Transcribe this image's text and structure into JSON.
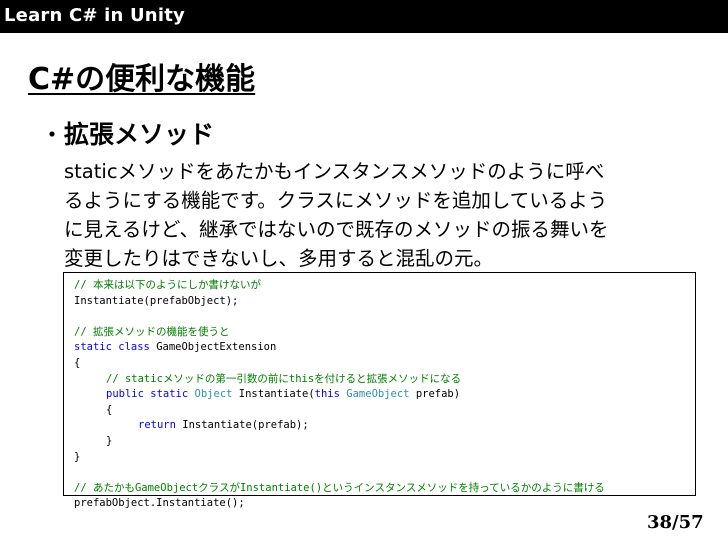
{
  "header": {
    "title": "Learn C# in Unity"
  },
  "slide": {
    "title": "C#の便利な機能",
    "bullet_mark": "・",
    "bullet_heading": "拡張メソッド",
    "body_lines": [
      "staticメソッドをあたかもインスタンスメソッドのように呼べ",
      "るようにする機能です。クラスにメソッドを追加しているよう",
      "に見えるけど、継承ではないので既存のメソッドの振る舞いを",
      "変更したりはできないし、多用すると混乱の元。"
    ]
  },
  "code": {
    "line1_comment": "// 本来は以下のようにしか書けないが",
    "line2": "Instantiate(prefabObject);",
    "line4_comment": "// 拡張メソッドの機能を使うと",
    "line5_kw1": "static",
    "line5_kw2": "class",
    "line5_name": " GameObjectExtension",
    "open_brace": "{",
    "close_brace": "}",
    "line7_comment": "// staticメソッドの第一引数の前にthisを付けると拡張メソッドになる",
    "line8_kw1": "public",
    "line8_kw2": "static",
    "line8_type1": "Object",
    "line8_mid": " Instantiate(",
    "line8_kw3": "this",
    "line8_type2": "GameObject",
    "line8_end": " prefab)",
    "line10_kw": "return",
    "line10_rest": " Instantiate(prefab);",
    "line14_comment": "// あたかもGameObjectクラスがInstantiate()というインスタンスメソッドを持っているかのように書ける",
    "line15": "prefabObject.Instantiate();"
  },
  "footer": {
    "page_number": "38/57"
  }
}
